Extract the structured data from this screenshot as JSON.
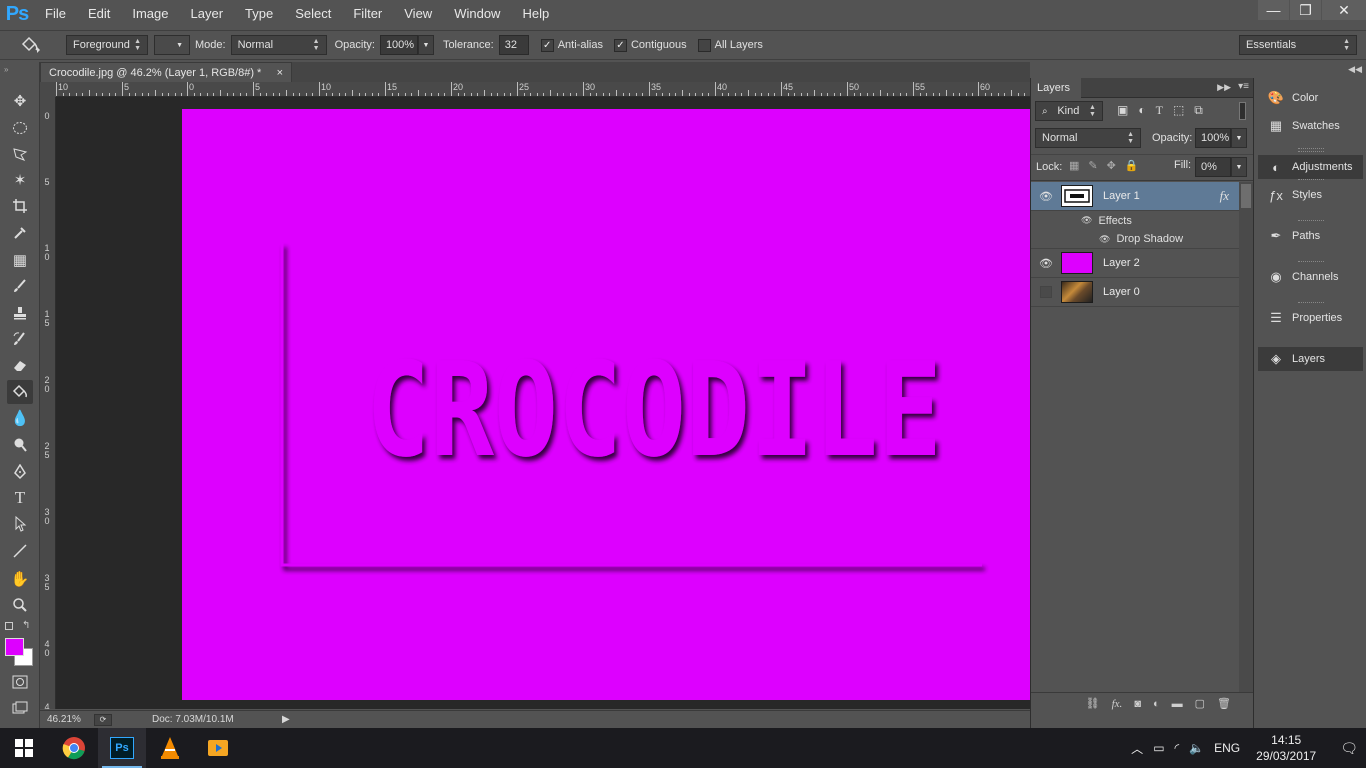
{
  "app": {
    "logo": "Ps"
  },
  "menu": [
    "File",
    "Edit",
    "Image",
    "Layer",
    "Type",
    "Select",
    "Filter",
    "View",
    "Window",
    "Help"
  ],
  "window_controls": {
    "minimize": "—",
    "maximize": "❐",
    "close": "✕"
  },
  "options": {
    "fill_source": "Foreground",
    "mode_label": "Mode:",
    "mode_value": "Normal",
    "opacity_label": "Opacity:",
    "opacity_value": "100%",
    "tolerance_label": "Tolerance:",
    "tolerance_value": "32",
    "anti_alias_label": "Anti-alias",
    "anti_alias_checked": true,
    "contiguous_label": "Contiguous",
    "contiguous_checked": true,
    "all_layers_label": "All Layers",
    "all_layers_checked": false,
    "workspace": "Essentials"
  },
  "document": {
    "tab_title": "Crocodile.jpg @ 46.2% (Layer 1, RGB/8#) *",
    "tab_close": "×",
    "canvas_text": "CROCODILE",
    "canvas_color": "#dd00ff"
  },
  "ruler_h": [
    "10",
    "5",
    "0",
    "5",
    "10",
    "15",
    "20",
    "25",
    "30",
    "35",
    "40",
    "45",
    "50",
    "55",
    "60"
  ],
  "ruler_v": [
    "0",
    "5",
    "1\n0",
    "1\n5",
    "2\n0",
    "2\n5",
    "3\n0",
    "3\n5",
    "4\n0",
    "4"
  ],
  "status": {
    "zoom": "46.21%",
    "doc": "Doc: 7.03M/10.1M"
  },
  "colors": {
    "foreground": "#dd00ff",
    "background": "#ffffff"
  },
  "layers_panel": {
    "tab": "Layers",
    "filter_kind": "Kind",
    "blend_mode": "Normal",
    "opacity_label": "Opacity:",
    "opacity_value": "100%",
    "lock_label": "Lock:",
    "fill_label": "Fill:",
    "fill_value": "0%",
    "fx": "fx",
    "layers": [
      {
        "name": "Layer 1",
        "visible": true,
        "selected": true,
        "effects_label": "Effects",
        "effect": "Drop Shadow"
      },
      {
        "name": "Layer 2",
        "visible": true,
        "selected": false,
        "thumb_color": "#dd00ff"
      },
      {
        "name": "Layer 0",
        "visible": false,
        "selected": false
      }
    ]
  },
  "right_panels": [
    {
      "label": "Color",
      "icon": "palette-icon"
    },
    {
      "label": "Swatches",
      "icon": "grid-icon"
    },
    {
      "label": "Adjustments",
      "icon": "adjust-icon",
      "active": true
    },
    {
      "label": "Styles",
      "icon": "fx-icon"
    },
    {
      "label": "Paths",
      "icon": "pen-path-icon"
    },
    {
      "label": "Channels",
      "icon": "channels-icon"
    },
    {
      "label": "Properties",
      "icon": "properties-icon"
    },
    {
      "label": "Layers",
      "icon": "layers-icon",
      "active": true
    }
  ],
  "taskbar": {
    "time": "14:15",
    "date": "29/03/2017",
    "lang": "ENG"
  }
}
